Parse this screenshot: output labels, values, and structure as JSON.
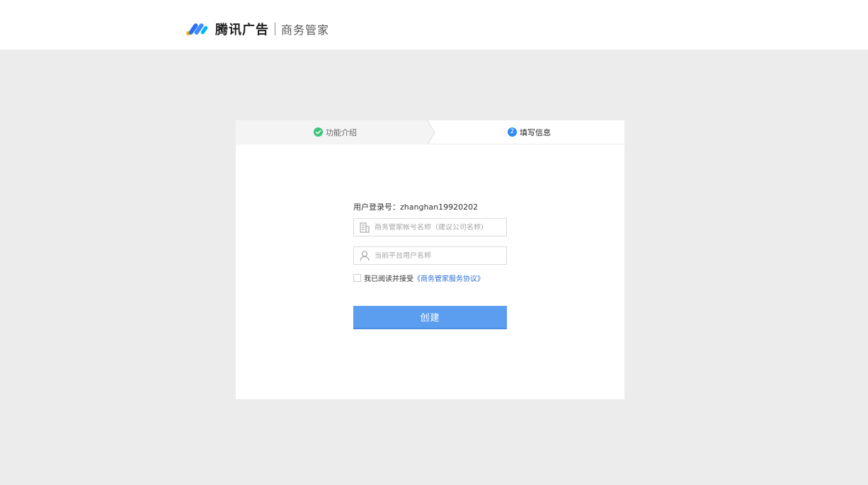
{
  "header": {
    "brand_name": "腾讯广告",
    "product_name": "商务管家",
    "logo_icon": "tencent-ads-logo"
  },
  "steps": [
    {
      "label": "功能介绍",
      "state": "done",
      "icon": "check-circle-icon"
    },
    {
      "label": "填写信息",
      "state": "active",
      "number": "2"
    }
  ],
  "form": {
    "login_label": "用户登录号：",
    "login_value": "zhanghan19920202",
    "account_name_placeholder": "商务管家帐号名称（建议公司名称)",
    "account_name_value": "",
    "user_name_placeholder": "当前平台用户名称",
    "user_name_value": "",
    "agree_text": "我已阅读并接受",
    "agree_link": "《商务管家服务协议》",
    "agree_checked": false,
    "submit_label": "创建"
  },
  "colors": {
    "accent": "#2d8cf0",
    "button": "#5b9ef0",
    "link": "#2d6fd6",
    "success": "#3cc47c",
    "background": "#ececec"
  }
}
